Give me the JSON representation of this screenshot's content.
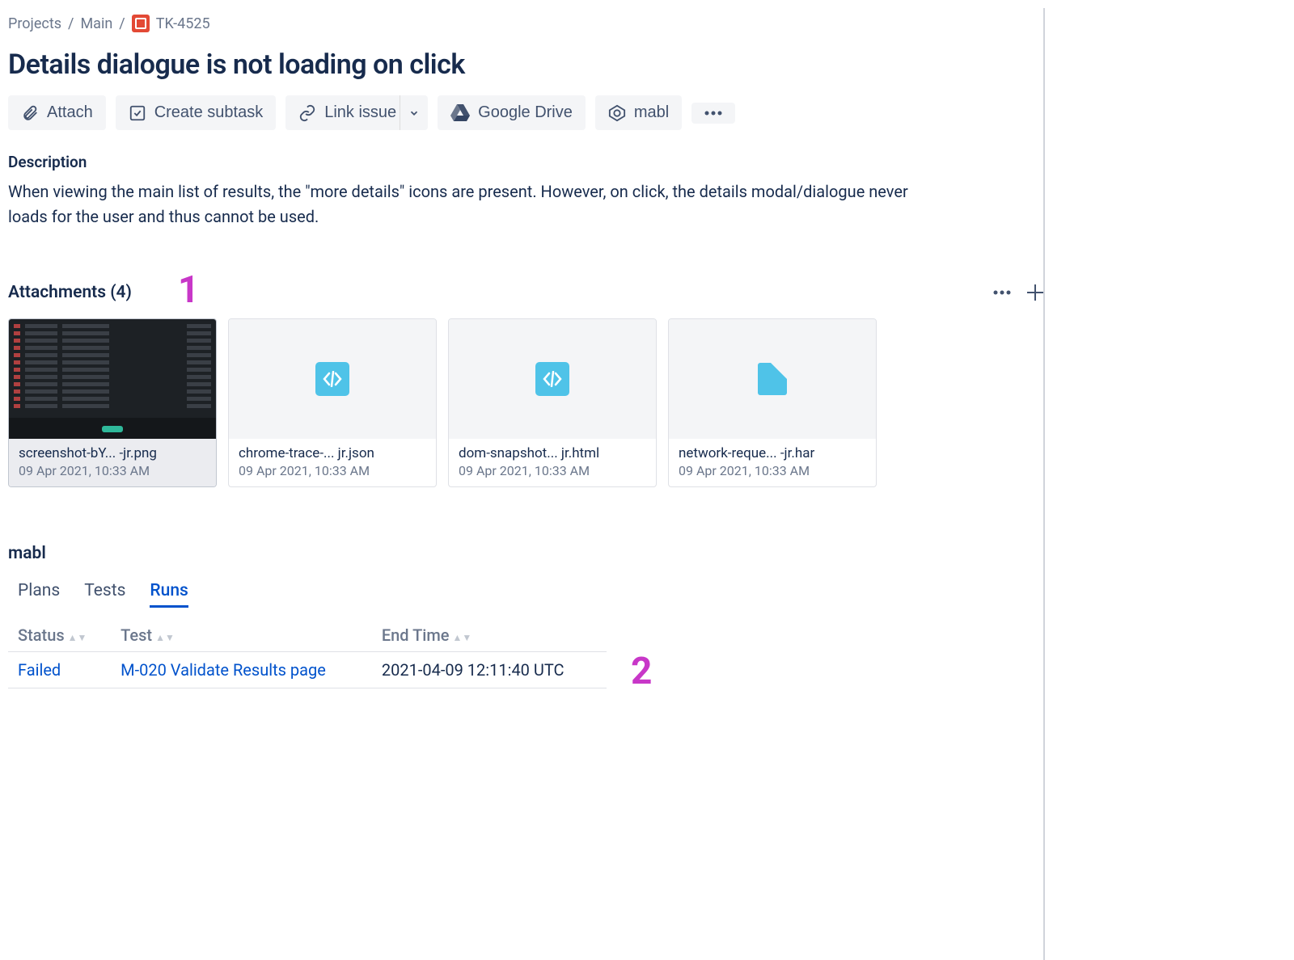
{
  "breadcrumb": {
    "projects": "Projects",
    "main": "Main",
    "key": "TK-4525"
  },
  "title": "Details dialogue is not loading on click",
  "toolbar": {
    "attach": "Attach",
    "create_subtask": "Create subtask",
    "link_issue": "Link issue",
    "google_drive": "Google Drive",
    "mabl": "mabl"
  },
  "description": {
    "heading": "Description",
    "body": "When viewing the main list of results, the \"more details\" icons are present. However, on click, the details modal/dialogue never loads for the user and thus cannot be used."
  },
  "attachments": {
    "heading": "Attachments (4)",
    "items": [
      {
        "name": "screenshot-bY... -jr.png",
        "date": "09 Apr 2021, 10:33 AM",
        "kind": "image"
      },
      {
        "name": "chrome-trace-... jr.json",
        "date": "09 Apr 2021, 10:33 AM",
        "kind": "code"
      },
      {
        "name": "dom-snapshot... jr.html",
        "date": "09 Apr 2021, 10:33 AM",
        "kind": "code"
      },
      {
        "name": "network-reque... -jr.har",
        "date": "09 Apr 2021, 10:33 AM",
        "kind": "file"
      }
    ]
  },
  "mabl": {
    "heading": "mabl",
    "tabs": {
      "plans": "Plans",
      "tests": "Tests",
      "runs": "Runs"
    },
    "table": {
      "headers": {
        "status": "Status",
        "test": "Test",
        "end_time": "End Time"
      },
      "row": {
        "status": "Failed",
        "test": "M-020 Validate Results page",
        "end_time": "2021-04-09 12:11:40 UTC"
      }
    }
  },
  "annotations": {
    "one": "1",
    "two": "2"
  }
}
